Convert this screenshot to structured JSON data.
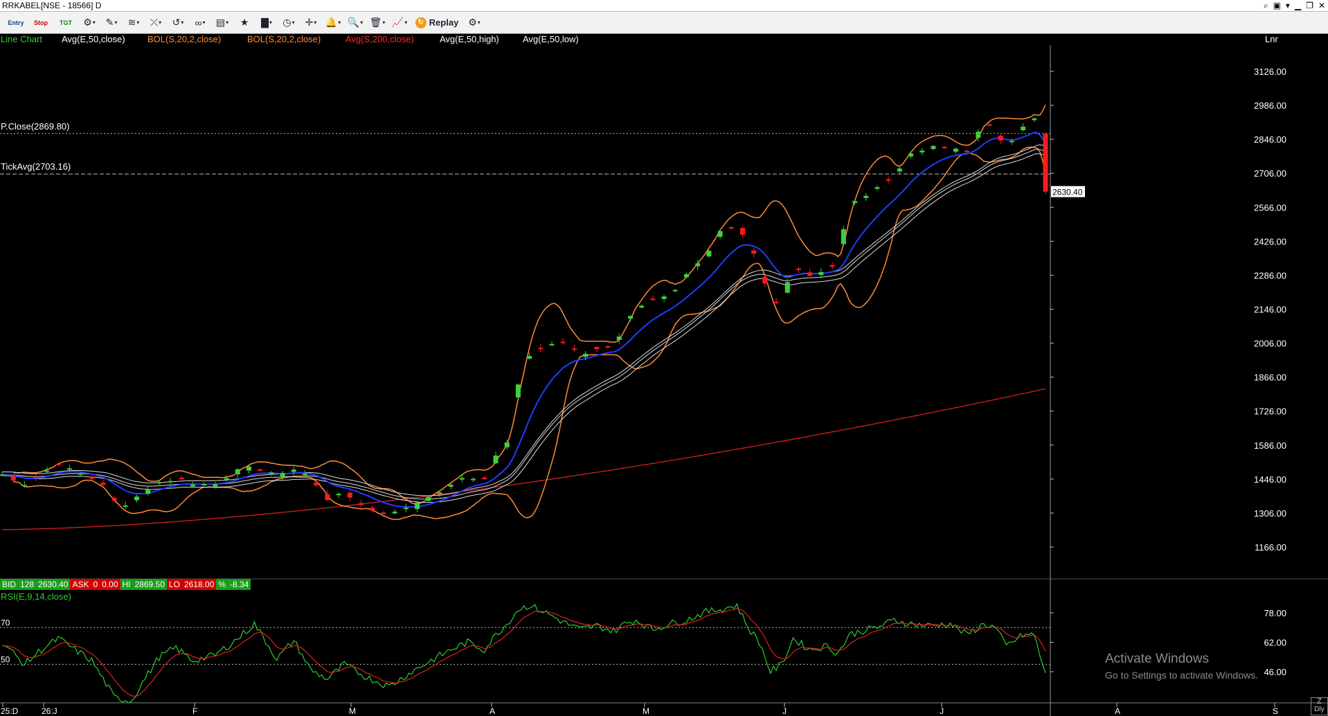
{
  "window": {
    "title": "RRKABEL[NSE - 18566] D",
    "controls": [
      "search-icon",
      "calc-icon",
      "chevron-down-icon",
      "minimize-icon",
      "restore-icon",
      "close-icon"
    ]
  },
  "toolbar": {
    "items": [
      {
        "name": "entry-button",
        "label": "Entry",
        "kind": "text"
      },
      {
        "name": "stop-button",
        "label": "Stop",
        "kind": "text"
      },
      {
        "name": "tgt-button",
        "label": "TGT",
        "kind": "text"
      },
      {
        "name": "chart-type-button",
        "label": "⚙",
        "kind": "icon"
      },
      {
        "name": "draw-tool-button",
        "label": "✎",
        "kind": "icon"
      },
      {
        "name": "study-button",
        "label": "≋",
        "kind": "icon"
      },
      {
        "name": "line-tool-button",
        "label": "⤫",
        "kind": "icon"
      },
      {
        "name": "fib-button",
        "label": "↺",
        "kind": "icon"
      },
      {
        "name": "link-button",
        "label": "∞",
        "kind": "icon"
      },
      {
        "name": "template-button",
        "label": "▤",
        "kind": "icon"
      },
      {
        "name": "favourite-button",
        "label": "★",
        "kind": "icon"
      },
      {
        "name": "bar-type-button",
        "label": "▇",
        "kind": "icon"
      },
      {
        "name": "clock-button",
        "label": "◷",
        "kind": "icon"
      },
      {
        "name": "crosshair-button",
        "label": "✛",
        "kind": "icon"
      },
      {
        "name": "alert-button",
        "label": "🔔",
        "kind": "icon"
      },
      {
        "name": "zoom-button",
        "label": "🔍",
        "kind": "icon"
      },
      {
        "name": "delete-button",
        "label": "🗑",
        "kind": "icon"
      },
      {
        "name": "compare-button",
        "label": "📈",
        "kind": "icon"
      }
    ],
    "replay_label": "Replay"
  },
  "legend": [
    {
      "text": "Line Chart",
      "color": "#32cd32"
    },
    {
      "text": "Avg(E,50,close)",
      "color": "#ffffff"
    },
    {
      "text": "BOL(S,20,2,close)",
      "color": "#ff8c3a"
    },
    {
      "text": "BOL(S,20,2,close)",
      "color": "#ff8c3a"
    },
    {
      "text": "Avg(S,200,close)",
      "color": "#ff2a2a"
    },
    {
      "text": "Avg(E,50,high)",
      "color": "#ffffff"
    },
    {
      "text": "Avg(E,50,low)",
      "color": "#ffffff"
    }
  ],
  "scale_mode": "Lnr",
  "reference_lines": {
    "pclose": {
      "label": "P.Close(2869.80)",
      "value": 2869.8
    },
    "tickavg": {
      "label": "TickAvg(2703.16)",
      "value": 2703.16
    }
  },
  "last_price": {
    "label": "2630.40",
    "value": 2630.4
  },
  "quote_bar": [
    {
      "text": "BID",
      "bg": "#1a9e1a"
    },
    {
      "text": "128",
      "bg": "#1a9e1a"
    },
    {
      "text": "2630.40",
      "bg": "#1a9e1a"
    },
    {
      "text": "ASK",
      "bg": "#d40000"
    },
    {
      "text": "0",
      "bg": "#d40000"
    },
    {
      "text": "0.00",
      "bg": "#d40000"
    },
    {
      "text": "HI",
      "bg": "#1a9e1a"
    },
    {
      "text": "2869.50",
      "bg": "#1a9e1a"
    },
    {
      "text": "LO",
      "bg": "#d40000"
    },
    {
      "text": "2618.00",
      "bg": "#d40000"
    },
    {
      "text": "%",
      "bg": "#1a9e1a"
    },
    {
      "text": "-8.34",
      "bg": "#1a9e1a"
    }
  ],
  "rsi_label": "RSI(E,9,14,close)",
  "watermark": {
    "line1": "Activate Windows",
    "line2": "Go to Settings to activate Windows."
  },
  "period_button": "Dly",
  "chart_data": {
    "type": "candlestick",
    "price_axis": {
      "ticks": [
        "3126.00",
        "2986.00",
        "2846.00",
        "2706.00",
        "2566.00",
        "2426.00",
        "2286.00",
        "2146.00",
        "2006.00",
        "1866.00",
        "1726.00",
        "1586.00",
        "1446.00",
        "1306.00",
        "1166.00"
      ],
      "range": [
        1026,
        3200
      ]
    },
    "x_axis_labels": [
      "25:D",
      "26:J",
      "F",
      "M",
      "A",
      "M",
      "J",
      "J",
      "A",
      "S"
    ],
    "price_anchors": [
      [
        0,
        1465
      ],
      [
        8,
        1425
      ],
      [
        14,
        1470
      ],
      [
        20,
        1505
      ],
      [
        26,
        1470
      ],
      [
        32,
        1450
      ],
      [
        36,
        1415
      ],
      [
        40,
        1350
      ],
      [
        44,
        1330
      ],
      [
        50,
        1390
      ],
      [
        56,
        1440
      ],
      [
        62,
        1450
      ],
      [
        68,
        1420
      ],
      [
        76,
        1430
      ],
      [
        84,
        1480
      ],
      [
        90,
        1495
      ],
      [
        98,
        1460
      ],
      [
        104,
        1480
      ],
      [
        110,
        1455
      ],
      [
        116,
        1365
      ],
      [
        122,
        1390
      ],
      [
        130,
        1330
      ],
      [
        138,
        1305
      ],
      [
        146,
        1330
      ],
      [
        154,
        1380
      ],
      [
        160,
        1430
      ],
      [
        166,
        1455
      ],
      [
        172,
        1450
      ],
      [
        176,
        1535
      ],
      [
        180,
        1600
      ],
      [
        184,
        1840
      ],
      [
        188,
        1960
      ],
      [
        194,
        2000
      ],
      [
        200,
        2000
      ],
      [
        206,
        1960
      ],
      [
        212,
        1990
      ],
      [
        218,
        1985
      ],
      [
        222,
        2090
      ],
      [
        226,
        2160
      ],
      [
        232,
        2180
      ],
      [
        238,
        2200
      ],
      [
        244,
        2290
      ],
      [
        250,
        2350
      ],
      [
        256,
        2460
      ],
      [
        262,
        2490
      ],
      [
        266,
        2410
      ],
      [
        270,
        2330
      ],
      [
        274,
        2180
      ],
      [
        278,
        2180
      ],
      [
        282,
        2330
      ],
      [
        288,
        2290
      ],
      [
        294,
        2310
      ],
      [
        298,
        2350
      ],
      [
        302,
        2590
      ],
      [
        306,
        2600
      ],
      [
        312,
        2640
      ],
      [
        318,
        2700
      ],
      [
        324,
        2790
      ],
      [
        330,
        2810
      ],
      [
        338,
        2810
      ],
      [
        344,
        2800
      ],
      [
        350,
        2920
      ],
      [
        354,
        2880
      ],
      [
        358,
        2820
      ],
      [
        364,
        2890
      ],
      [
        368,
        2930
      ],
      [
        372,
        2630
      ]
    ],
    "rsi_axis": {
      "ticks": [
        "78.00",
        "62.00",
        "46.00"
      ],
      "levels": [
        {
          "label": "70",
          "value": 70
        },
        {
          "label": "50",
          "value": 50
        }
      ],
      "range": [
        30,
        86
      ]
    },
    "rsi_anchors": [
      [
        0,
        62
      ],
      [
        8,
        50
      ],
      [
        14,
        58
      ],
      [
        20,
        64
      ],
      [
        26,
        58
      ],
      [
        32,
        52
      ],
      [
        36,
        42
      ],
      [
        40,
        32
      ],
      [
        46,
        30
      ],
      [
        50,
        40
      ],
      [
        56,
        54
      ],
      [
        62,
        59
      ],
      [
        68,
        52
      ],
      [
        76,
        55
      ],
      [
        84,
        64
      ],
      [
        90,
        72
      ],
      [
        98,
        53
      ],
      [
        104,
        63
      ],
      [
        110,
        47
      ],
      [
        116,
        42
      ],
      [
        122,
        50
      ],
      [
        130,
        43
      ],
      [
        138,
        38
      ],
      [
        146,
        46
      ],
      [
        154,
        53
      ],
      [
        160,
        58
      ],
      [
        166,
        62
      ],
      [
        172,
        58
      ],
      [
        176,
        66
      ],
      [
        180,
        72
      ],
      [
        184,
        80
      ],
      [
        188,
        82
      ],
      [
        194,
        78
      ],
      [
        200,
        73
      ],
      [
        206,
        69
      ],
      [
        212,
        71
      ],
      [
        218,
        68
      ],
      [
        222,
        72
      ],
      [
        226,
        74
      ],
      [
        232,
        69
      ],
      [
        238,
        72
      ],
      [
        244,
        74
      ],
      [
        250,
        78
      ],
      [
        256,
        80
      ],
      [
        262,
        82
      ],
      [
        266,
        70
      ],
      [
        270,
        62
      ],
      [
        274,
        46
      ],
      [
        278,
        50
      ],
      [
        282,
        64
      ],
      [
        288,
        58
      ],
      [
        294,
        60
      ],
      [
        298,
        56
      ],
      [
        302,
        66
      ],
      [
        306,
        68
      ],
      [
        312,
        70
      ],
      [
        318,
        74
      ],
      [
        324,
        72
      ],
      [
        330,
        71
      ],
      [
        338,
        72
      ],
      [
        344,
        66
      ],
      [
        350,
        72
      ],
      [
        354,
        70
      ],
      [
        358,
        60
      ],
      [
        364,
        66
      ],
      [
        368,
        66
      ],
      [
        372,
        44
      ]
    ]
  }
}
